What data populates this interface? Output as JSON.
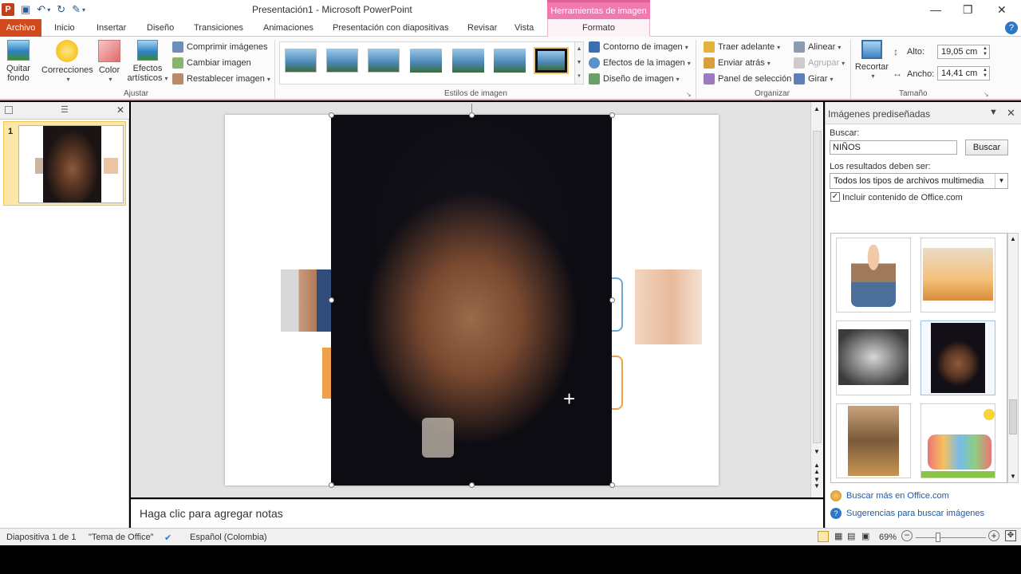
{
  "title": "Presentación1  -  Microsoft PowerPoint",
  "context_tab": "Herramientas de imagen",
  "tabs": [
    "Archivo",
    "Inicio",
    "Insertar",
    "Diseño",
    "Transiciones",
    "Animaciones",
    "Presentación con diapositivas",
    "Revisar",
    "Vista",
    "Formato"
  ],
  "ribbon": {
    "ajustar": {
      "label": "Ajustar",
      "quitar_fondo": [
        "Quitar",
        "fondo"
      ],
      "correcciones": "Correcciones",
      "color": "Color",
      "efectos": [
        "Efectos",
        "artísticos"
      ],
      "comprimir": "Comprimir imágenes",
      "cambiar": "Cambiar imagen",
      "restablecer": "Restablecer imagen"
    },
    "estilos": {
      "label": "Estilos de imagen",
      "contorno": "Contorno de imagen",
      "efectos": "Efectos de la imagen",
      "diseno": "Diseño de imagen"
    },
    "organizar": {
      "label": "Organizar",
      "traer": "Traer adelante",
      "enviar": "Enviar atrás",
      "panel": "Panel de selección",
      "alinear": "Alinear",
      "agrupar": "Agrupar",
      "girar": "Girar"
    },
    "tamano": {
      "label": "Tamaño",
      "recortar": "Recortar",
      "alto_label": "Alto:",
      "alto_value": "19,05 cm",
      "ancho_label": "Ancho:",
      "ancho_value": "14,41 cm"
    }
  },
  "slides_pane": {
    "slide_number": "1"
  },
  "notes_placeholder": "Haga clic para agregar notas",
  "taskpane": {
    "title": "Imágenes prediseñadas",
    "search_label": "Buscar:",
    "search_value": "NIÑOS",
    "search_button": "Buscar",
    "results_label": "Los resultados deben ser:",
    "results_type": "Todos los tipos de archivos multimedia",
    "include_office": "Incluir contenido de Office.com",
    "link_more": "Buscar más en Office.com",
    "link_tips": "Sugerencias para buscar imágenes"
  },
  "statusbar": {
    "slide_info": "Diapositiva 1 de 1",
    "theme": "\"Tema de Office\"",
    "language": "Español (Colombia)",
    "zoom": "69%"
  },
  "colors": {
    "file_tab": "#d04a1c",
    "context_tab": "#f07ab0",
    "link": "#1f5aa8"
  }
}
